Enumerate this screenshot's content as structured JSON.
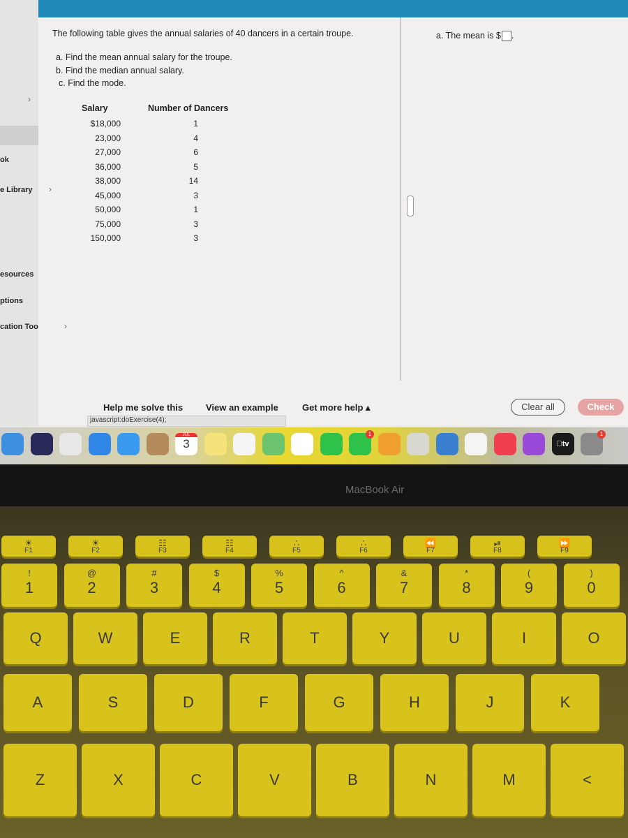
{
  "sidebar": {
    "items": [
      {
        "label": "ok",
        "chevron": false
      },
      {
        "label": "e Library",
        "chevron": true
      },
      {
        "label": "esources",
        "chevron": false
      },
      {
        "label": "ptions",
        "chevron": false
      },
      {
        "label": "cation Tools",
        "chevron": true
      }
    ]
  },
  "problem": {
    "intro": "The following table gives the annual salaries of 40 dancers in a certain troupe.",
    "parts": [
      "a. Find the mean annual salary for the troupe.",
      "b. Find the median annual salary.",
      "c. Find the mode."
    ],
    "table": {
      "headers": [
        "Salary",
        "Number of Dancers"
      ],
      "rows": [
        [
          "$18,000",
          "1"
        ],
        [
          "23,000",
          "4"
        ],
        [
          "27,000",
          "6"
        ],
        [
          "36,000",
          "5"
        ],
        [
          "38,000",
          "14"
        ],
        [
          "45,000",
          "3"
        ],
        [
          "50,000",
          "1"
        ],
        [
          "75,000",
          "3"
        ],
        [
          "150,000",
          "3"
        ]
      ]
    }
  },
  "answer": {
    "label": "a. The mean is $",
    "value": "",
    "suffix": "."
  },
  "actions": {
    "help": "Help me solve this",
    "example": "View an example",
    "more": "Get more help ▴",
    "clear": "Clear all",
    "check": "Check"
  },
  "status_bar": "javascript:doExercise(4);",
  "dock": {
    "calendar_month": "JUL",
    "calendar_day": "3",
    "apps": [
      {
        "name": "finder",
        "color": "#3d8fe0"
      },
      {
        "name": "siri",
        "color": "#2a2a5a"
      },
      {
        "name": "launchpad",
        "color": "#e8e8e8"
      },
      {
        "name": "safari",
        "color": "#2f86e6"
      },
      {
        "name": "mail",
        "color": "#3a9af0"
      },
      {
        "name": "contacts",
        "color": "#b48a5a"
      },
      {
        "name": "calendar",
        "color": "#ffffff"
      },
      {
        "name": "notes",
        "color": "#f6e27a"
      },
      {
        "name": "reminders",
        "color": "#f5f5f5"
      },
      {
        "name": "maps",
        "color": "#6bc46d"
      },
      {
        "name": "photos",
        "color": "#ffffff"
      },
      {
        "name": "messages",
        "color": "#2ec24a"
      },
      {
        "name": "facetime",
        "color": "#2ec24a",
        "badge": "1"
      },
      {
        "name": "pages",
        "color": "#f0a030"
      },
      {
        "name": "numbers",
        "color": "#d8d8d0"
      },
      {
        "name": "keynote",
        "color": "#3a7fd0"
      },
      {
        "name": "news",
        "color": "#f4f4f4"
      },
      {
        "name": "music",
        "color": "#f0404f"
      },
      {
        "name": "podcasts",
        "color": "#9a4ad8"
      },
      {
        "name": "tv",
        "color": "#1a1a1a",
        "label": "tv"
      },
      {
        "name": "system-preferences",
        "color": "#8a8a8a",
        "badge": "1"
      }
    ]
  },
  "device": {
    "brand": "MacBook Air"
  },
  "keyboard": {
    "fn": [
      [
        "☀",
        "F1"
      ],
      [
        "☀",
        "F2"
      ],
      [
        "☷",
        "F3"
      ],
      [
        "☷",
        "F4"
      ],
      [
        "∴",
        "F5"
      ],
      [
        "∴",
        "F6"
      ],
      [
        "⏪",
        "F7"
      ],
      [
        "⏯",
        "F8"
      ],
      [
        "⏩",
        "F9"
      ]
    ],
    "numbers": [
      [
        "!",
        "1"
      ],
      [
        "@",
        "2"
      ],
      [
        "#",
        "3"
      ],
      [
        "$",
        "4"
      ],
      [
        "%",
        "5"
      ],
      [
        "^",
        "6"
      ],
      [
        "&",
        "7"
      ],
      [
        "*",
        "8"
      ],
      [
        "(",
        "9"
      ],
      [
        ")",
        "0"
      ]
    ],
    "row1": [
      "Q",
      "W",
      "E",
      "R",
      "T",
      "Y",
      "U",
      "I",
      "O"
    ],
    "row2": [
      "A",
      "S",
      "D",
      "F",
      "G",
      "H",
      "J",
      "K"
    ],
    "row3": [
      "Z",
      "X",
      "C",
      "V",
      "B",
      "N",
      "M",
      "<"
    ]
  }
}
